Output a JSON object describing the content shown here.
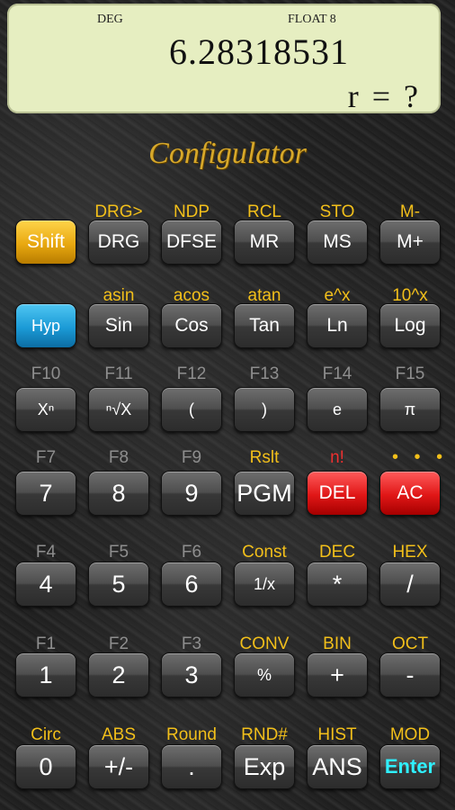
{
  "display": {
    "angle_mode": "DEG",
    "format_mode": "FLOAT 8",
    "value": "6.28318531",
    "prompt": "r = ?"
  },
  "app": {
    "logo_text": "Configulator"
  },
  "rows": [
    {
      "labels": [
        {
          "text": "",
          "color": "gold"
        },
        {
          "text": "DRG>",
          "color": "gold"
        },
        {
          "text": "NDP",
          "color": "gold"
        },
        {
          "text": "RCL",
          "color": "gold"
        },
        {
          "text": "STO",
          "color": "gold"
        },
        {
          "text": "M-",
          "color": "gold"
        }
      ],
      "keys": [
        "Shift",
        "DRG",
        "DFSE",
        "MR",
        "MS",
        "M+"
      ]
    },
    {
      "labels": [
        {
          "text": "",
          "color": "gold"
        },
        {
          "text": "asin",
          "color": "gold"
        },
        {
          "text": "acos",
          "color": "gold"
        },
        {
          "text": "atan",
          "color": "gold"
        },
        {
          "text": "e^x",
          "color": "gold"
        },
        {
          "text": "10^x",
          "color": "gold"
        }
      ],
      "keys": [
        "Hyp",
        "Sin",
        "Cos",
        "Tan",
        "Ln",
        "Log"
      ]
    },
    {
      "labels": [
        {
          "text": "F10",
          "color": "gray"
        },
        {
          "text": "F11",
          "color": "gray"
        },
        {
          "text": "F12",
          "color": "gray"
        },
        {
          "text": "F13",
          "color": "gray"
        },
        {
          "text": "F14",
          "color": "gray"
        },
        {
          "text": "F15",
          "color": "gray"
        }
      ],
      "keys": [
        "Xⁿ",
        "ⁿ√X",
        "(",
        ")",
        "e",
        "π"
      ]
    },
    {
      "labels": [
        {
          "text": "F7",
          "color": "gray"
        },
        {
          "text": "F8",
          "color": "gray"
        },
        {
          "text": "F9",
          "color": "gray"
        },
        {
          "text": "Rslt",
          "color": "gold"
        },
        {
          "text": "n!",
          "color": "red"
        },
        {
          "text": "",
          "color": "gold"
        }
      ],
      "keys": [
        "7",
        "8",
        "9",
        "PGM",
        "DEL",
        "AC"
      ]
    },
    {
      "labels": [
        {
          "text": "F4",
          "color": "gray"
        },
        {
          "text": "F5",
          "color": "gray"
        },
        {
          "text": "F6",
          "color": "gray"
        },
        {
          "text": "Const",
          "color": "gold"
        },
        {
          "text": "DEC",
          "color": "gold"
        },
        {
          "text": "HEX",
          "color": "gold"
        }
      ],
      "keys": [
        "4",
        "5",
        "6",
        "1/x",
        "*",
        "/"
      ]
    },
    {
      "labels": [
        {
          "text": "F1",
          "color": "gray"
        },
        {
          "text": "F2",
          "color": "gray"
        },
        {
          "text": "F3",
          "color": "gray"
        },
        {
          "text": "CONV",
          "color": "gold"
        },
        {
          "text": "BIN",
          "color": "gold"
        },
        {
          "text": "OCT",
          "color": "gold"
        }
      ],
      "keys": [
        "1",
        "2",
        "3",
        "%",
        "+",
        "-"
      ]
    },
    {
      "labels": [
        {
          "text": "Circ",
          "color": "gold"
        },
        {
          "text": "ABS",
          "color": "gold"
        },
        {
          "text": "Round",
          "color": "gold"
        },
        {
          "text": "RND#",
          "color": "gold"
        },
        {
          "text": "HIST",
          "color": "gold"
        },
        {
          "text": "MOD",
          "color": "gold"
        }
      ],
      "keys": [
        "0",
        "+/-",
        ".",
        "Exp",
        "ANS",
        "Enter"
      ]
    }
  ],
  "ac_dots": "• • •"
}
